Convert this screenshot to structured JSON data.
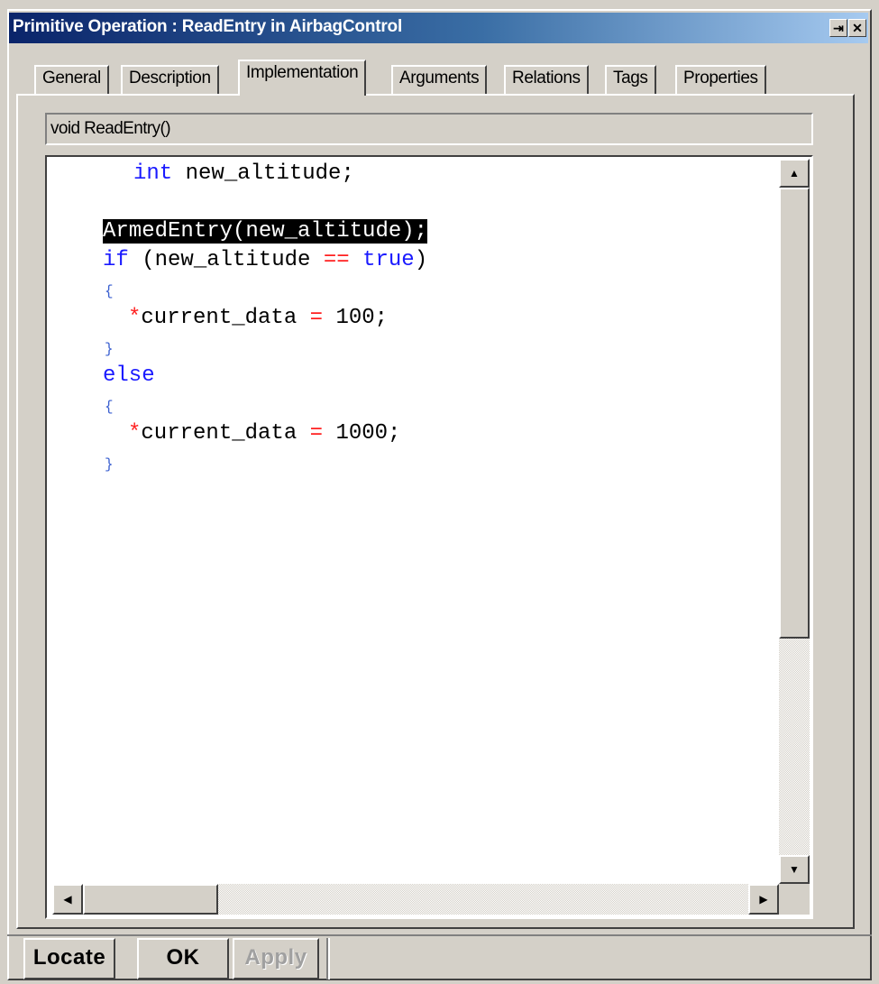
{
  "window": {
    "title": "Primitive Operation : ReadEntry in AirbagControl",
    "pin_glyph": "⇥",
    "close_glyph": "✕"
  },
  "tabs": [
    {
      "label": "General"
    },
    {
      "label": "Description"
    },
    {
      "label": "Implementation"
    },
    {
      "label": "Arguments"
    },
    {
      "label": "Relations"
    },
    {
      "label": "Tags"
    },
    {
      "label": "Properties"
    }
  ],
  "active_tab": "Implementation",
  "signature": "void ReadEntry()",
  "code": {
    "line1_type": "int",
    "line1_rest": " new_altitude;",
    "line2_selected": "ArmedEntry(new_altitude);",
    "line3_if": "if",
    "line3_mid": " (new_altitude ",
    "line3_op": "==",
    "line3_sp": " ",
    "line3_true": "true",
    "line3_end": ")",
    "open_brace": "{",
    "close_brace": "}",
    "star": "*",
    "assign_var": "current_data ",
    "eq": "=",
    "val1": " 100;",
    "else_kw": "else",
    "val2": " 1000;"
  },
  "scroll": {
    "up": "▲",
    "down": "▼",
    "left": "◀",
    "right": "▶"
  },
  "buttons": {
    "locate": "Locate",
    "ok": "OK",
    "apply": "Apply"
  },
  "colors": {
    "titlebar_start": "#0a246a",
    "keyword": "#1a1aff",
    "operator": "#ff2020",
    "selection_bg": "#000000"
  }
}
